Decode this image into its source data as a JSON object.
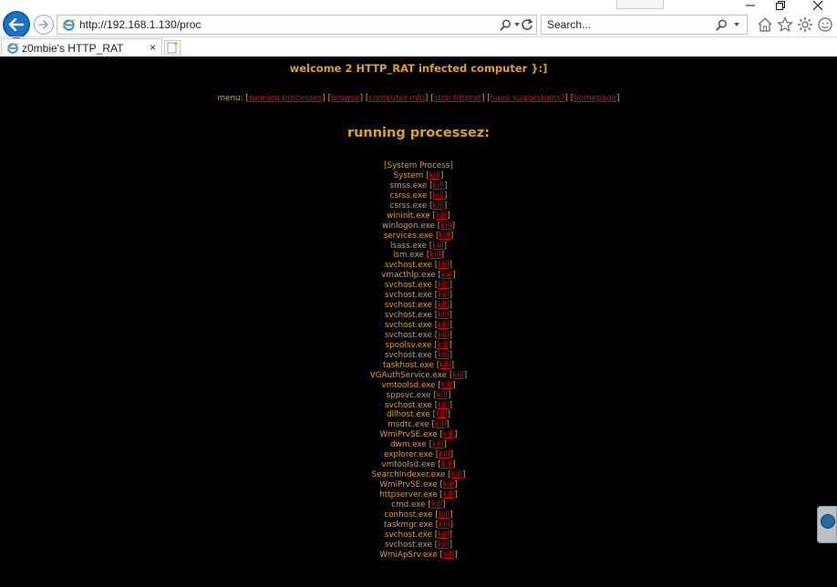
{
  "browser": {
    "url": "http://192.168.1.130/proc",
    "search_placeholder": "Search...",
    "tab_title": "z0mbie's HTTP_RAT",
    "tab_close": "×"
  },
  "page": {
    "welcome": "welcome 2 HTTP_RAT infected computer }:]",
    "menu_label": "menu: ",
    "menu_items": [
      {
        "label": "running processes"
      },
      {
        "label": "browse"
      },
      {
        "label": "computer info"
      },
      {
        "label": "stop httprat"
      },
      {
        "label": "have suggestions?"
      },
      {
        "label": "homepage"
      }
    ],
    "heading": "running processez:",
    "kill_label": "kill",
    "system_process": "[System Process]",
    "processes": [
      "System",
      "smss.exe",
      "csrss.exe",
      "csrss.exe",
      "wininit.exe",
      "winlogon.exe",
      "services.exe",
      "lsass.exe",
      "lsm.exe",
      "svchost.exe",
      "vmacthlp.exe",
      "svchost.exe",
      "svchost.exe",
      "svchost.exe",
      "svchost.exe",
      "svchost.exe",
      "svchost.exe",
      "spoolsv.exe",
      "svchost.exe",
      "taskhost.exe",
      "VGAuthService.exe",
      "vmtoolsd.exe",
      "sppsvc.exe",
      "svchost.exe",
      "dllhost.exe",
      "msdtc.exe",
      "WmiPrvSE.exe",
      "dwm.exe",
      "explorer.exe",
      "vmtoolsd.exe",
      "SearchIndexer.exe",
      "WmiPrvSE.exe",
      "httpserver.exe",
      "cmd.exe",
      "conhost.exe",
      "taskmgr.exe",
      "svchost.exe",
      "svchost.exe",
      "WmiApSrv.exe"
    ]
  },
  "colors": {
    "page_background": "#000000",
    "text": "#e0a020",
    "link": "#e00000",
    "ie_blue": "#1a73c8"
  }
}
